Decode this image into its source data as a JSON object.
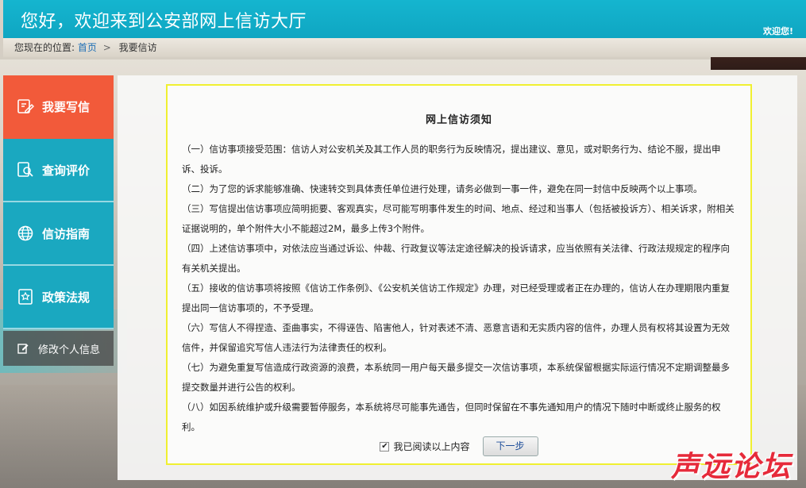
{
  "header": {
    "title": "您好，欢迎来到公安部网上信访大厅",
    "welcome": "欢迎您!"
  },
  "breadcrumb": {
    "prefix": "您现在的位置:",
    "home": "首页",
    "sep": ">",
    "current": "我要信访"
  },
  "sidebar": {
    "items": [
      {
        "label": "我要写信",
        "icon": "write-icon"
      },
      {
        "label": "查询评价",
        "icon": "search-doc-icon"
      },
      {
        "label": "信访指南",
        "icon": "globe-icon"
      },
      {
        "label": "政策法规",
        "icon": "law-book-icon"
      }
    ],
    "profile": {
      "label": "修改个人信息",
      "icon": "edit-icon"
    }
  },
  "notice": {
    "title": "网上信访须知",
    "items": [
      "（一）信访事项接受范围：信访人对公安机关及其工作人员的职务行为反映情况，提出建议、意见，或对职务行为、结论不服，提出申诉、投诉。",
      "（二）为了您的诉求能够准确、快速转交到具体责任单位进行处理，请务必做到一事一件，避免在同一封信中反映两个以上事项。",
      "（三）写信提出信访事项应简明扼要、客观真实，尽可能写明事件发生的时间、地点、经过和当事人（包括被投诉方）、相关诉求，附相关证据说明的，单个附件大小不能超过2M，最多上传3个附件。",
      "（四）上述信访事项中，对依法应当通过诉讼、仲裁、行政复议等法定途径解决的投诉请求，应当依照有关法律、行政法规规定的程序向有关机关提出。",
      "（五）接收的信访事项将按照《信访工作条例》、《公安机关信访工作规定》办理，对已经受理或者正在办理的，信访人在办理期限内重复提出同一信访事项的，不予受理。",
      "（六）写信人不得捏造、歪曲事实，不得诬告、陷害他人，针对表述不清、恶意言语和无实质内容的信件，办理人员有权将其设置为无效信件，并保留追究写信人违法行为法律责任的权利。",
      "（七）为避免重复写信造成行政资源的浪费，本系统同一用户每天最多提交一次信访事项，本系统保留根据实际运行情况不定期调整最多提交数量并进行公告的权利。",
      "（八）如因系统维护或升级需要暂停服务，本系统将尽可能事先通告，但同时保留在不事先通知用户的情况下随时中断或终止服务的权利。"
    ],
    "agree_label": "我已阅读以上内容",
    "agree_checked": true,
    "next_label": "下一步"
  },
  "watermark": "声远论坛",
  "colors": {
    "header": "#15b5cf",
    "sidebar": "#1aa8c0",
    "active": "#f25a3a",
    "notice_border": "#f0f030",
    "watermark": "#e62a3a"
  }
}
